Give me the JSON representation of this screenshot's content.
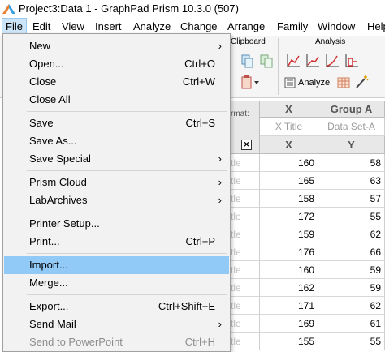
{
  "window": {
    "title": "Project3:Data 1 - GraphPad Prism 10.3.0 (507)"
  },
  "menubar": [
    "File",
    "Edit",
    "View",
    "Insert",
    "Analyze",
    "Change",
    "Arrange",
    "Family",
    "Window",
    "Help"
  ],
  "ribbon": {
    "clipboard_label": "Clipboard",
    "analysis_label": "Analysis",
    "analyze_button": "Analyze"
  },
  "sheet": {
    "format_label": "rmat:",
    "col_x": {
      "header": "X",
      "title_placeholder": "X Title",
      "sub": "X"
    },
    "col_a": {
      "header": "Group A",
      "title_placeholder": "Data Set-A",
      "sub": "Y"
    },
    "row_title_fragment": "tle",
    "close_box": "✕",
    "rows": [
      {
        "x": "160",
        "y": "58"
      },
      {
        "x": "165",
        "y": "63"
      },
      {
        "x": "158",
        "y": "57"
      },
      {
        "x": "172",
        "y": "55"
      },
      {
        "x": "159",
        "y": "62"
      },
      {
        "x": "176",
        "y": "66"
      },
      {
        "x": "160",
        "y": "59"
      },
      {
        "x": "162",
        "y": "59"
      },
      {
        "x": "171",
        "y": "62"
      },
      {
        "x": "169",
        "y": "61"
      },
      {
        "x": "155",
        "y": "55"
      }
    ]
  },
  "file_menu": {
    "groups": [
      [
        {
          "label": "New",
          "submenu": true
        },
        {
          "label": "Open...",
          "shortcut": "Ctrl+O"
        },
        {
          "label": "Close",
          "shortcut": "Ctrl+W"
        },
        {
          "label": "Close All"
        }
      ],
      [
        {
          "label": "Save",
          "shortcut": "Ctrl+S"
        },
        {
          "label": "Save As..."
        },
        {
          "label": "Save Special",
          "submenu": true
        }
      ],
      [
        {
          "label": "Prism Cloud",
          "submenu": true
        },
        {
          "label": "LabArchives",
          "submenu": true
        }
      ],
      [
        {
          "label": "Printer Setup..."
        },
        {
          "label": "Print...",
          "shortcut": "Ctrl+P"
        }
      ],
      [
        {
          "label": "Import...",
          "highlighted": true
        },
        {
          "label": "Merge..."
        }
      ],
      [
        {
          "label": "Export...",
          "shortcut": "Ctrl+Shift+E"
        },
        {
          "label": "Send Mail",
          "submenu": true
        },
        {
          "label": "Send to PowerPoint",
          "shortcut": "Ctrl+H",
          "disabled": true
        }
      ]
    ]
  },
  "colors": {
    "menu_highlight": "#91c9f7",
    "active_menu": "#cce4f7"
  },
  "icons": [
    "prism-app-icon",
    "graph-icon",
    "submenu-arrow-icon",
    "close-box-icon"
  ]
}
